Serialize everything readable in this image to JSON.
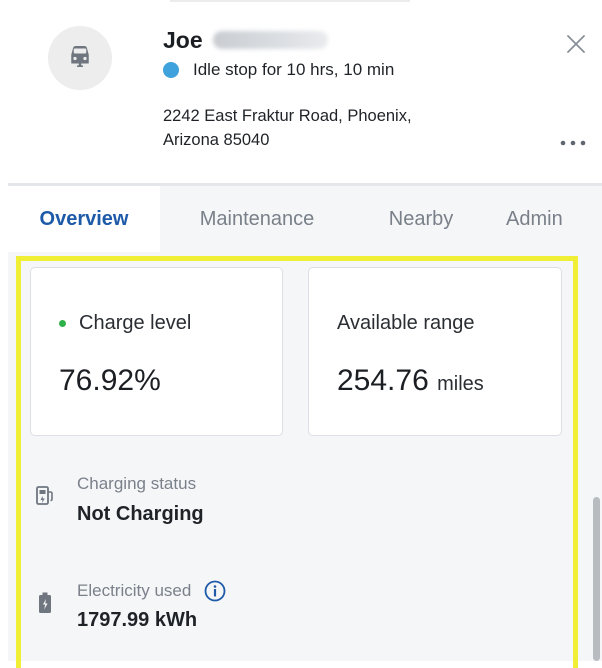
{
  "driver": {
    "first_name": "Joe",
    "status_text": "Idle stop for 10 hrs, 10 min",
    "address_line1": "2242 East Fraktur Road, Phoenix,",
    "address_line2": "Arizona 85040",
    "status_color": "#3fa2dc"
  },
  "icons": {
    "avatar": "vehicle-icon",
    "close": "close-icon",
    "more": "more-horizontal-icon",
    "charging": "ev-charger-icon",
    "battery": "battery-icon",
    "info": "info-icon"
  },
  "tabs": [
    {
      "label": "Overview",
      "active": true
    },
    {
      "label": "Maintenance",
      "active": false
    },
    {
      "label": "Nearby",
      "active": false
    },
    {
      "label": "Admin",
      "active": false
    }
  ],
  "metrics": {
    "charge_level": {
      "label": "Charge level",
      "value": "76.92%"
    },
    "available_range": {
      "label": "Available range",
      "value": "254.76",
      "unit": "miles"
    }
  },
  "details": {
    "charging_status": {
      "label": "Charging status",
      "value": "Not Charging"
    },
    "electricity_used": {
      "label": "Electricity used",
      "value": "1797.99 kWh"
    }
  },
  "colors": {
    "accent": "#1d5aa7",
    "highlight": "#f0ee35",
    "charge_dot": "#2fb14a"
  }
}
